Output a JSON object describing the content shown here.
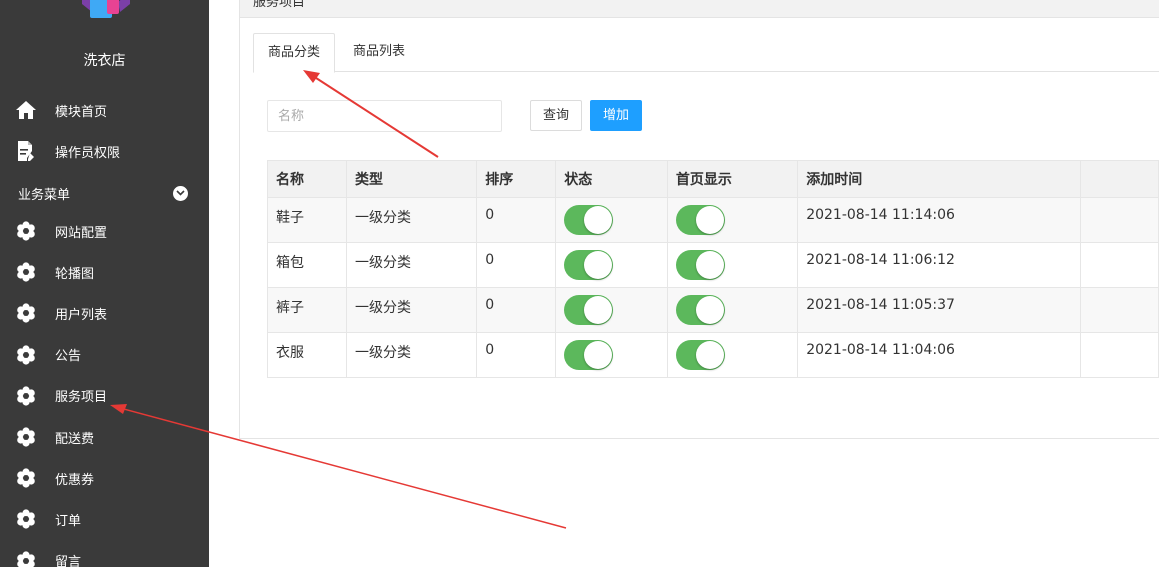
{
  "sidebar": {
    "shop_name": "洗衣店",
    "top_items": [
      {
        "label": "模块首页",
        "icon": "home-icon"
      },
      {
        "label": "操作员权限",
        "icon": "document-edit-icon"
      }
    ],
    "group": {
      "label": "业务菜单",
      "icon": "chevron-down-icon"
    },
    "items": [
      {
        "label": "网站配置",
        "icon": "gear-icon"
      },
      {
        "label": "轮播图",
        "icon": "gear-icon"
      },
      {
        "label": "用户列表",
        "icon": "gear-icon"
      },
      {
        "label": "公告",
        "icon": "gear-icon"
      },
      {
        "label": "服务项目",
        "icon": "gear-icon"
      },
      {
        "label": "配送费",
        "icon": "gear-icon"
      },
      {
        "label": "优惠券",
        "icon": "gear-icon"
      },
      {
        "label": "订单",
        "icon": "gear-icon"
      },
      {
        "label": "留言",
        "icon": "gear-icon"
      }
    ]
  },
  "panel": {
    "title": "服务项目"
  },
  "tabs": [
    {
      "label": "商品分类",
      "active": true
    },
    {
      "label": "商品列表",
      "active": false
    }
  ],
  "search": {
    "placeholder": "名称",
    "value": "",
    "query_label": "查询",
    "add_label": "增加"
  },
  "table": {
    "columns": [
      "名称",
      "类型",
      "排序",
      "状态",
      "首页显示",
      "添加时间"
    ],
    "rows": [
      {
        "name": "鞋子",
        "type": "一级分类",
        "sort": "0",
        "status_on": true,
        "home_on": true,
        "time": "2021-08-14 11:14:06"
      },
      {
        "name": "箱包",
        "type": "一级分类",
        "sort": "0",
        "status_on": true,
        "home_on": true,
        "time": "2021-08-14 11:06:12"
      },
      {
        "name": "裤子",
        "type": "一级分类",
        "sort": "0",
        "status_on": true,
        "home_on": true,
        "time": "2021-08-14 11:05:37"
      },
      {
        "name": "衣服",
        "type": "一级分类",
        "sort": "0",
        "status_on": true,
        "home_on": true,
        "time": "2021-08-14 11:04:06"
      }
    ]
  },
  "colors": {
    "sidebar_bg": "#3a3a3a",
    "accent": "#1e9fff",
    "toggle_on": "#5cb85c",
    "annotation": "#e53935"
  }
}
